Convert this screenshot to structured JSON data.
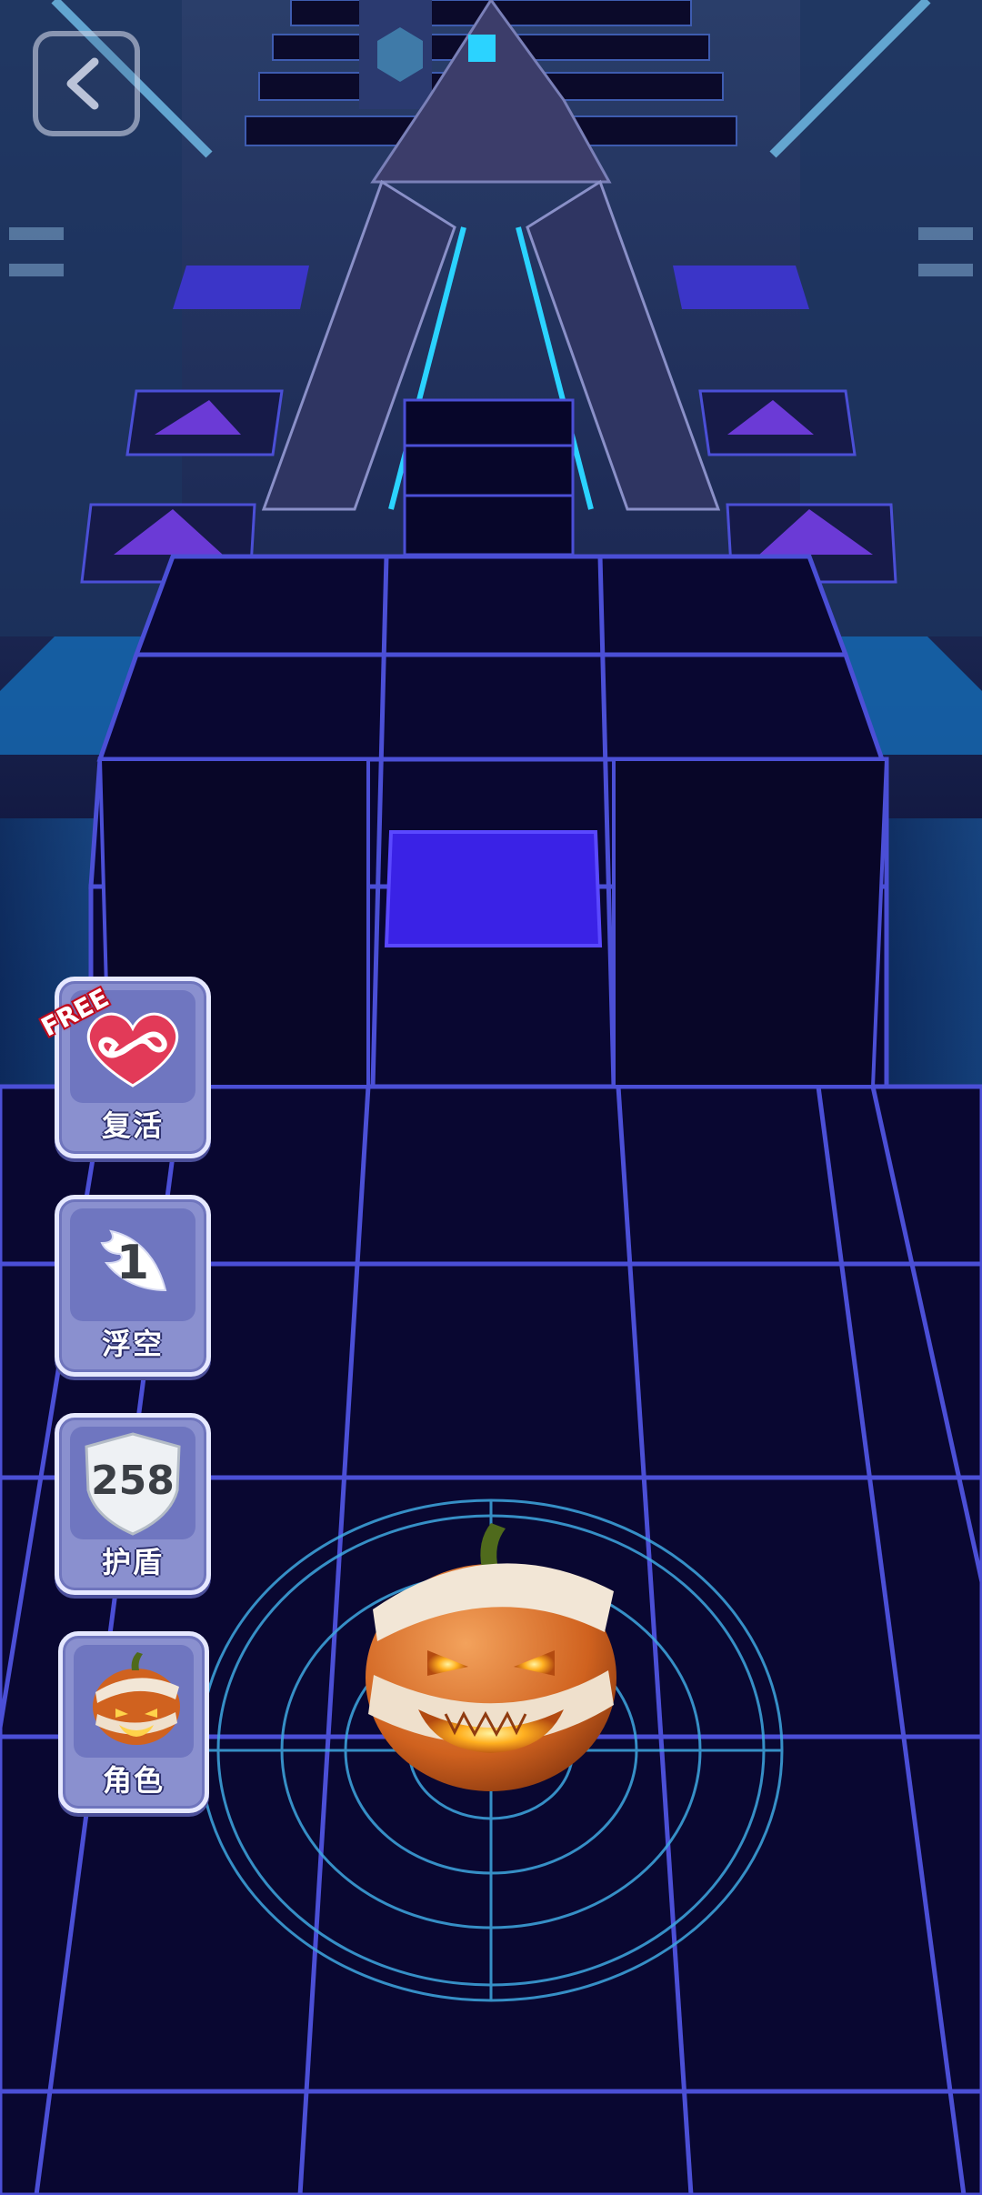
{
  "hud": {
    "back_icon": "chevron-left-icon",
    "revive": {
      "label": "复活",
      "badge": "FREE",
      "icon": "infinity-heart-icon"
    },
    "float": {
      "label": "浮空",
      "count": "1",
      "icon": "wing-icon"
    },
    "shield": {
      "label": "护盾",
      "count": "258",
      "icon": "shield-icon"
    },
    "character": {
      "label": "角色",
      "icon": "mummy-pumpkin-icon"
    }
  },
  "colors": {
    "grid_line": "#4b4fd6",
    "tile": "#0a0833",
    "highlight_tile": "#3a22e6",
    "side_glow": "#1a5fa8",
    "button_bg": "#8a90cf"
  }
}
